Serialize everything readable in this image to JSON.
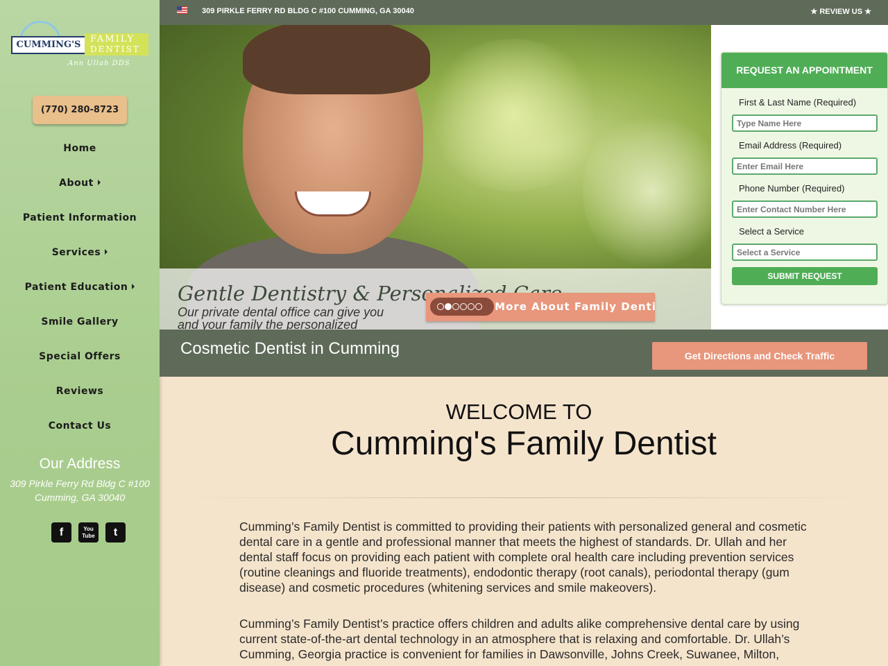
{
  "colors": {
    "sidebar_green": "#a9cd8e",
    "topbar_gray_green": "#5f6b59",
    "button_salmon": "#e8967c",
    "phone_button": "#e9bf8c",
    "form_green": "#4fae55",
    "content_bg": "#f5e4cc"
  },
  "logo": {
    "box_text": "CUMMING'S",
    "word1": "FAMILY",
    "word2": "DENTIST",
    "signature": "Ann Ullah DDS"
  },
  "sidebar": {
    "phone": "(770) 280-8723",
    "nav": [
      {
        "label": "Home",
        "has_submenu": false
      },
      {
        "label": "About",
        "has_submenu": true
      },
      {
        "label": "Patient Information",
        "has_submenu": false
      },
      {
        "label": "Services",
        "has_submenu": true
      },
      {
        "label": "Patient Education",
        "has_submenu": true
      },
      {
        "label": "Smile Gallery",
        "has_submenu": false
      },
      {
        "label": "Special Offers",
        "has_submenu": false
      },
      {
        "label": "Reviews",
        "has_submenu": false
      },
      {
        "label": "Contact Us",
        "has_submenu": false
      }
    ],
    "address_title": "Our Address",
    "address_line1": "309 Pirkle Ferry Rd Bldg C #100",
    "address_line2": "Cumming, GA 30040",
    "social": [
      {
        "icon": "facebook-icon",
        "glyph": "f"
      },
      {
        "icon": "youtube-icon",
        "glyph": "You Tube"
      },
      {
        "icon": "twitter-icon",
        "glyph": "t"
      }
    ]
  },
  "topbar": {
    "flag_icon": "us-flag-icon",
    "address": "309 PIRKLE FERRY RD BLDG C #100 CUMMING, GA 30040",
    "review": "★ REVIEW US ★"
  },
  "hero": {
    "script_title": "Gentle Dentistry & Personalized Care",
    "subtitle": "Our private dental office can give you and your family the personalized",
    "learn_button": "Learn More About Family Dentistry",
    "slides_total": 6,
    "slide_active": 2
  },
  "appointment": {
    "heading": "REQUEST AN APPOINTMENT",
    "fields": [
      {
        "label": "First & Last Name (Required)",
        "placeholder": "Type Name Here"
      },
      {
        "label": "Email Address (Required)",
        "placeholder": "Enter Email Here"
      },
      {
        "label": "Phone Number (Required)",
        "placeholder": "Enter Contact Number Here"
      },
      {
        "label": "Select a Service",
        "placeholder": "Select a Service"
      }
    ],
    "submit": "SUBMIT REQUEST"
  },
  "strip": {
    "title": "Cosmetic Dentist in Cumming",
    "directions": "Get Directions and Check Traffic"
  },
  "main": {
    "welcome_small": "WELCOME TO",
    "welcome_big": "Cumming's Family Dentist",
    "paragraphs": [
      "Cumming’s Family Dentist is committed to providing their patients with personalized general and cosmetic dental care in a gentle and professional manner that meets the highest of standards. Dr. Ullah and her dental staff focus on providing each patient with complete oral health care including prevention services (routine cleanings and fluoride treatments), endodontic therapy (root canals), periodontal therapy (gum disease) and cosmetic procedures (whitening services and smile makeovers).",
      "Cumming’s Family Dentist’s practice offers children and adults alike comprehensive dental care by using current state-of-the-art dental technology in an atmosphere that is relaxing and comfortable. Dr. Ullah’s Cumming, Georgia practice is convenient for families in Dawsonville, Johns Creek, Suwanee, Milton,"
    ]
  }
}
